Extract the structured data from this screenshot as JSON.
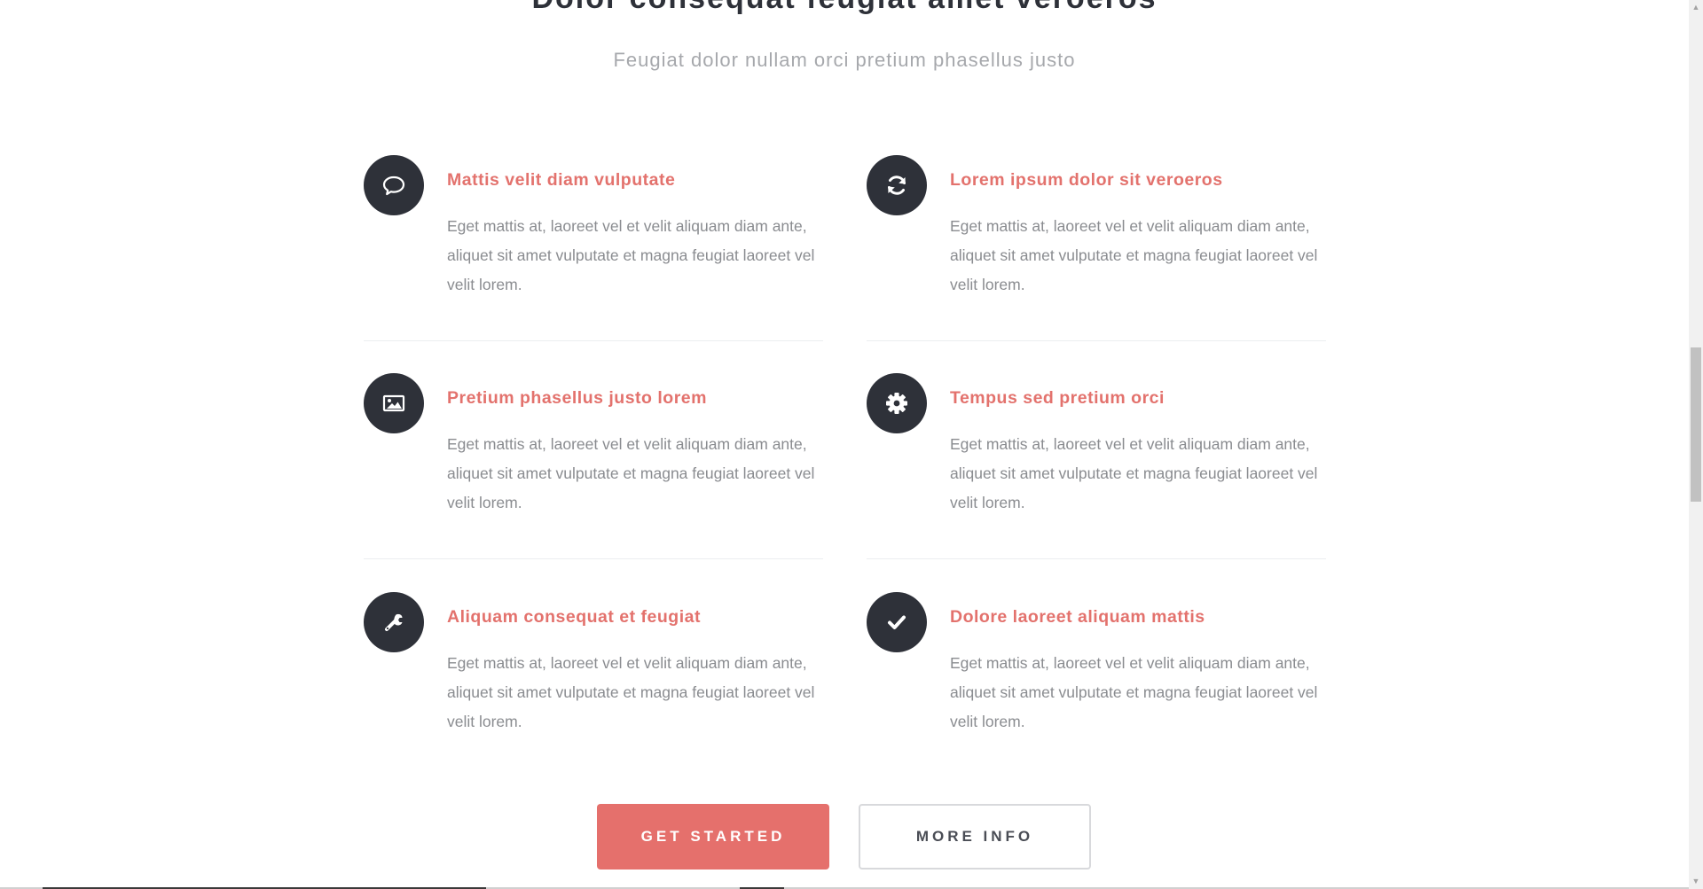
{
  "header": {
    "title": "Dolor consequat feugiat amet veroeros",
    "subtitle": "Feugiat dolor nullam orci pretium phasellus justo"
  },
  "features": [
    {
      "icon": "speech-bubble-icon",
      "title": "Mattis velit diam vulputate",
      "text": "Eget mattis at, laoreet vel et velit aliquam diam ante, aliquet sit amet vulputate et magna feugiat laoreet vel velit lorem."
    },
    {
      "icon": "refresh-icon",
      "title": "Lorem ipsum dolor sit veroeros",
      "text": "Eget mattis at, laoreet vel et velit aliquam diam ante, aliquet sit amet vulputate et magna feugiat laoreet vel velit lorem."
    },
    {
      "icon": "picture-icon",
      "title": "Pretium phasellus justo lorem",
      "text": "Eget mattis at, laoreet vel et velit aliquam diam ante, aliquet sit amet vulputate et magna feugiat laoreet vel velit lorem."
    },
    {
      "icon": "gear-icon",
      "title": "Tempus sed pretium orci",
      "text": "Eget mattis at, laoreet vel et velit aliquam diam ante, aliquet sit amet vulputate et magna feugiat laoreet vel velit lorem."
    },
    {
      "icon": "wrench-icon",
      "title": "Aliquam consequat et feugiat",
      "text": "Eget mattis at, laoreet vel et velit aliquam diam ante, aliquet sit amet vulputate et magna feugiat laoreet vel velit lorem."
    },
    {
      "icon": "checkmark-icon",
      "title": "Dolore laoreet aliquam mattis",
      "text": "Eget mattis at, laoreet vel et velit aliquam diam ante, aliquet sit amet vulputate et magna feugiat laoreet vel velit lorem."
    }
  ],
  "actions": {
    "primary_label": "GET STARTED",
    "secondary_label": "MORE INFO"
  },
  "colors": {
    "accent": "#e5706c",
    "icon_background": "#2e3139",
    "heading": "#2e3139",
    "body_text": "#8a8c90",
    "subtitle": "#a6a8ac"
  }
}
